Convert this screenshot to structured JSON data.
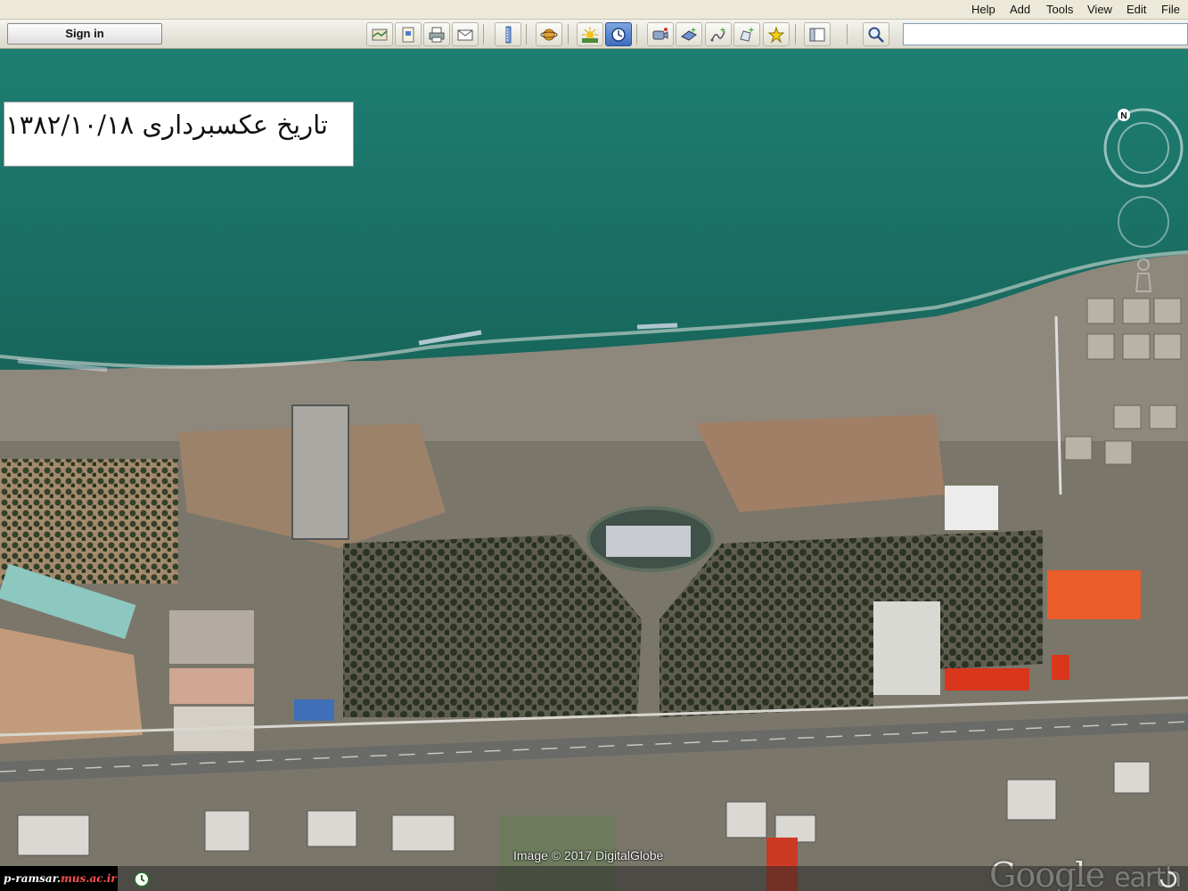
{
  "menu": {
    "items": [
      "File",
      "Edit",
      "View",
      "Tools",
      "Add",
      "Help"
    ]
  },
  "toolbar": {
    "signin_label": "Sign in",
    "search_value": "",
    "buttons": [
      "hide-sidebar-icon",
      "add-placemark-icon",
      "add-polygon-icon",
      "add-path-icon",
      "add-image-overlay-icon",
      "record-tour-icon",
      "historical-imagery-icon",
      "sunlight-icon",
      "switch-planet-icon",
      "ruler-icon",
      "email-icon",
      "print-icon",
      "save-image-icon",
      "view-in-maps-icon"
    ],
    "active_button": "historical-imagery-icon"
  },
  "map": {
    "date_label": "تاریخ عکسبرداری ۱۳۸۲/۱۰/۱۸",
    "attribution": "Image © 2017 DigitalGlobe",
    "logo": {
      "brand": "Google",
      "product": "earth"
    },
    "compass_letter": "N"
  },
  "status": {
    "watermark_prefix": "p-ramsar.",
    "watermark_domain": "mus.ac.ir"
  },
  "colors": {
    "sea": "#1f7a6e",
    "beach": "#8a8478",
    "vegetation": "#3d4a35",
    "road": "#6f6f6f"
  }
}
